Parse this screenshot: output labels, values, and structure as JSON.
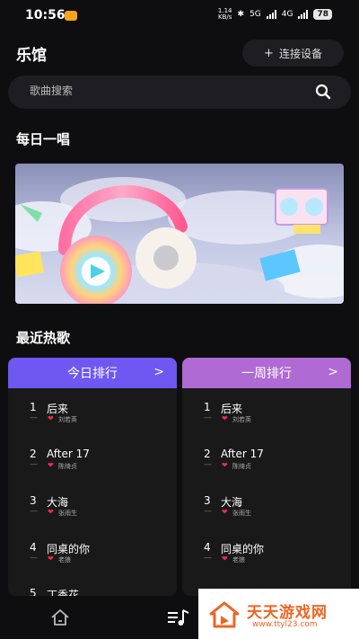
{
  "status_bar": {
    "time": "10:56",
    "speed_value": "1.14",
    "speed_unit": "KB/s",
    "network_a": "5G",
    "network_b": "4G",
    "battery": "78"
  },
  "header": {
    "title": "乐馆",
    "connect_button": "连接设备"
  },
  "search": {
    "placeholder": "歌曲搜索"
  },
  "daily": {
    "title": "每日一唱"
  },
  "hot": {
    "title": "最近热歌",
    "cards": [
      {
        "title": "今日排行",
        "chevron": ">",
        "color": "#6f57f2",
        "items": [
          {
            "rank": "1",
            "title": "后来",
            "artist": "刘若英"
          },
          {
            "rank": "2",
            "title": "After 17",
            "artist": "陈绮贞"
          },
          {
            "rank": "3",
            "title": "大海",
            "artist": "张雨生"
          },
          {
            "rank": "4",
            "title": "同桌的你",
            "artist": "老狼"
          },
          {
            "rank": "5",
            "title": "丁香花",
            "artist": ""
          }
        ]
      },
      {
        "title": "一周排行",
        "chevron": ">",
        "color": "#b06ad4",
        "items": [
          {
            "rank": "1",
            "title": "后来",
            "artist": "刘若英"
          },
          {
            "rank": "2",
            "title": "After 17",
            "artist": "陈绮贞"
          },
          {
            "rank": "3",
            "title": "大海",
            "artist": "张雨生"
          },
          {
            "rank": "4",
            "title": "同桌的你",
            "artist": "老狼"
          }
        ]
      }
    ]
  },
  "tab_bar": {
    "active_tab": "music"
  },
  "watermark": {
    "main": "天天游戏网",
    "url": "www.ttyl23.com"
  },
  "colors": {
    "background": "#0e0e10",
    "surface": "#1e1e22",
    "card_background": "#191919",
    "accent_today": "#6f57f2",
    "accent_week": "#b06ad4",
    "heart": "#ee2c49",
    "watermark_orange": "#f06421"
  },
  "icons": {
    "search": "search-icon",
    "home": "home-icon",
    "music": "music-list-icon",
    "heart": "heart-icon",
    "chevron": "chevron-right-icon",
    "plus": "plus-icon"
  }
}
